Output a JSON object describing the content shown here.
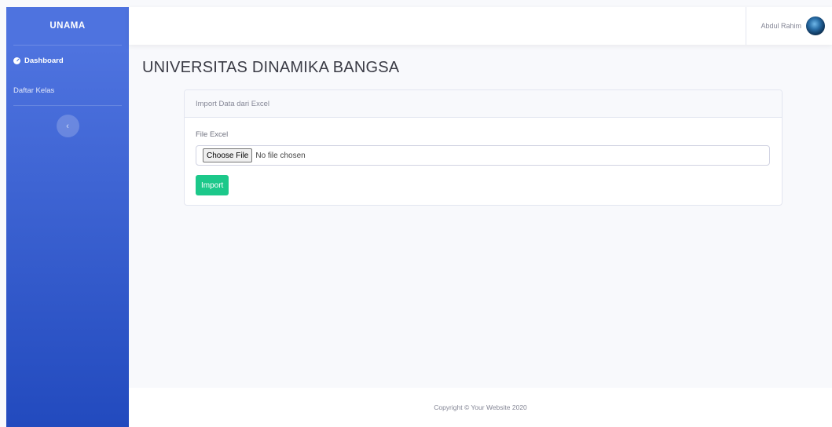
{
  "sidebar": {
    "brand": "UNAMA",
    "items": [
      {
        "label": "Dashboard",
        "icon": "tachometer-icon",
        "active": true
      },
      {
        "label": "Daftar Kelas",
        "icon": "",
        "active": false
      }
    ],
    "toggle_glyph": "‹"
  },
  "topbar": {
    "user_name": "Abdul Rahim",
    "avatar": "globe-avatar"
  },
  "main": {
    "title": "UNIVERSITAS DINAMIKA BANGSA",
    "card": {
      "header": "Import Data dari Excel",
      "field_label": "File Excel",
      "file_button": "Choose File",
      "file_status": "No file chosen",
      "submit_label": "Import"
    }
  },
  "footer": {
    "text": "Copyright © Your Website 2020"
  },
  "colors": {
    "sidebar_top": "#4e73df",
    "sidebar_bottom": "#224abe",
    "success": "#1cc88a",
    "background": "#f8f9fc"
  }
}
